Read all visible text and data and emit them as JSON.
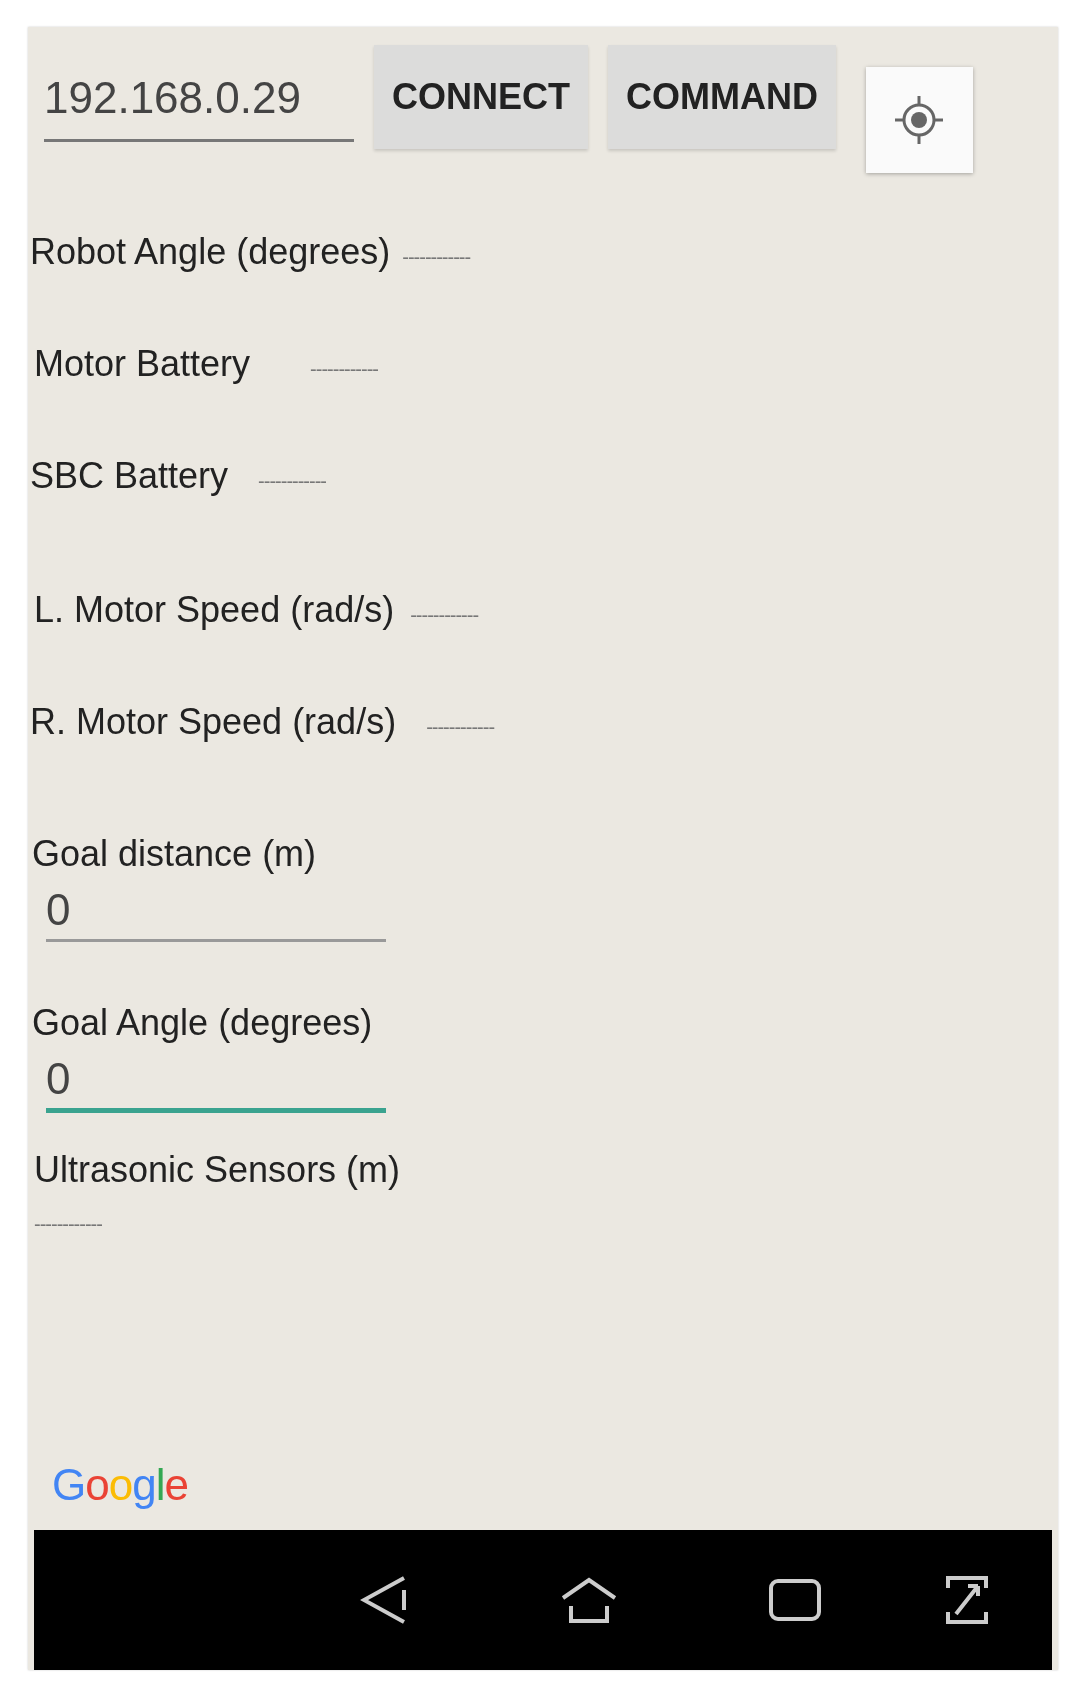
{
  "top_bar": {
    "address_field": {
      "value": "192.168.0.29"
    },
    "buttons": [
      {
        "label": "CONNECT"
      },
      {
        "label": "COMMAND"
      }
    ]
  },
  "readings": [
    {
      "label": "Robot Angle (degrees)",
      "value": "------------"
    },
    {
      "label": "Motor Battery",
      "value": "------------"
    },
    {
      "label": "SBC Battery",
      "value": "------------"
    },
    {
      "label": "L. Motor Speed (rad/s)",
      "value": "------------"
    },
    {
      "label": "R. Motor Speed (rad/s)",
      "value": "------------"
    }
  ],
  "goal_fields": [
    {
      "label": "Goal distance (m)",
      "value": "0",
      "focused": false
    },
    {
      "label": "Goal Angle (degrees)",
      "value": "0",
      "focused": true
    }
  ],
  "ultrasonic": {
    "label": "Ultrasonic Sensors (m)",
    "value": "------------"
  },
  "map_logo": "Google"
}
